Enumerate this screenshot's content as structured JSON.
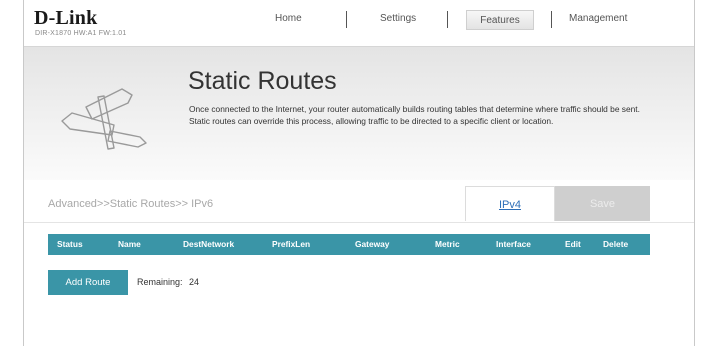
{
  "brand": {
    "logo": "D-Link",
    "model": "DIR-X1870 HW:A1 FW:1.01"
  },
  "nav": {
    "home": "Home",
    "settings": "Settings",
    "features": "Features",
    "management": "Management"
  },
  "banner": {
    "title": "Static Routes",
    "description": "Once connected to the Internet, your router automatically builds routing tables that determine where traffic should be sent. Static routes can override this process, allowing traffic to be directed to a specific client or location.",
    "icon": "signpost-icon"
  },
  "breadcrumb": "Advanced>>Static Routes>> IPv6",
  "buttons": {
    "ipv4": "IPv4",
    "save": "Save",
    "add_route": "Add Route"
  },
  "table": {
    "columns": [
      "Status",
      "Name",
      "DestNetwork",
      "PrefixLen",
      "Gateway",
      "Metric",
      "Interface",
      "Edit",
      "Delete"
    ],
    "rows": []
  },
  "remaining": {
    "label": "Remaining:",
    "value": "24"
  },
  "colors": {
    "accent": "#3a95a7",
    "link": "#2c6eb8",
    "save_disabled": "#cfcfcf"
  }
}
